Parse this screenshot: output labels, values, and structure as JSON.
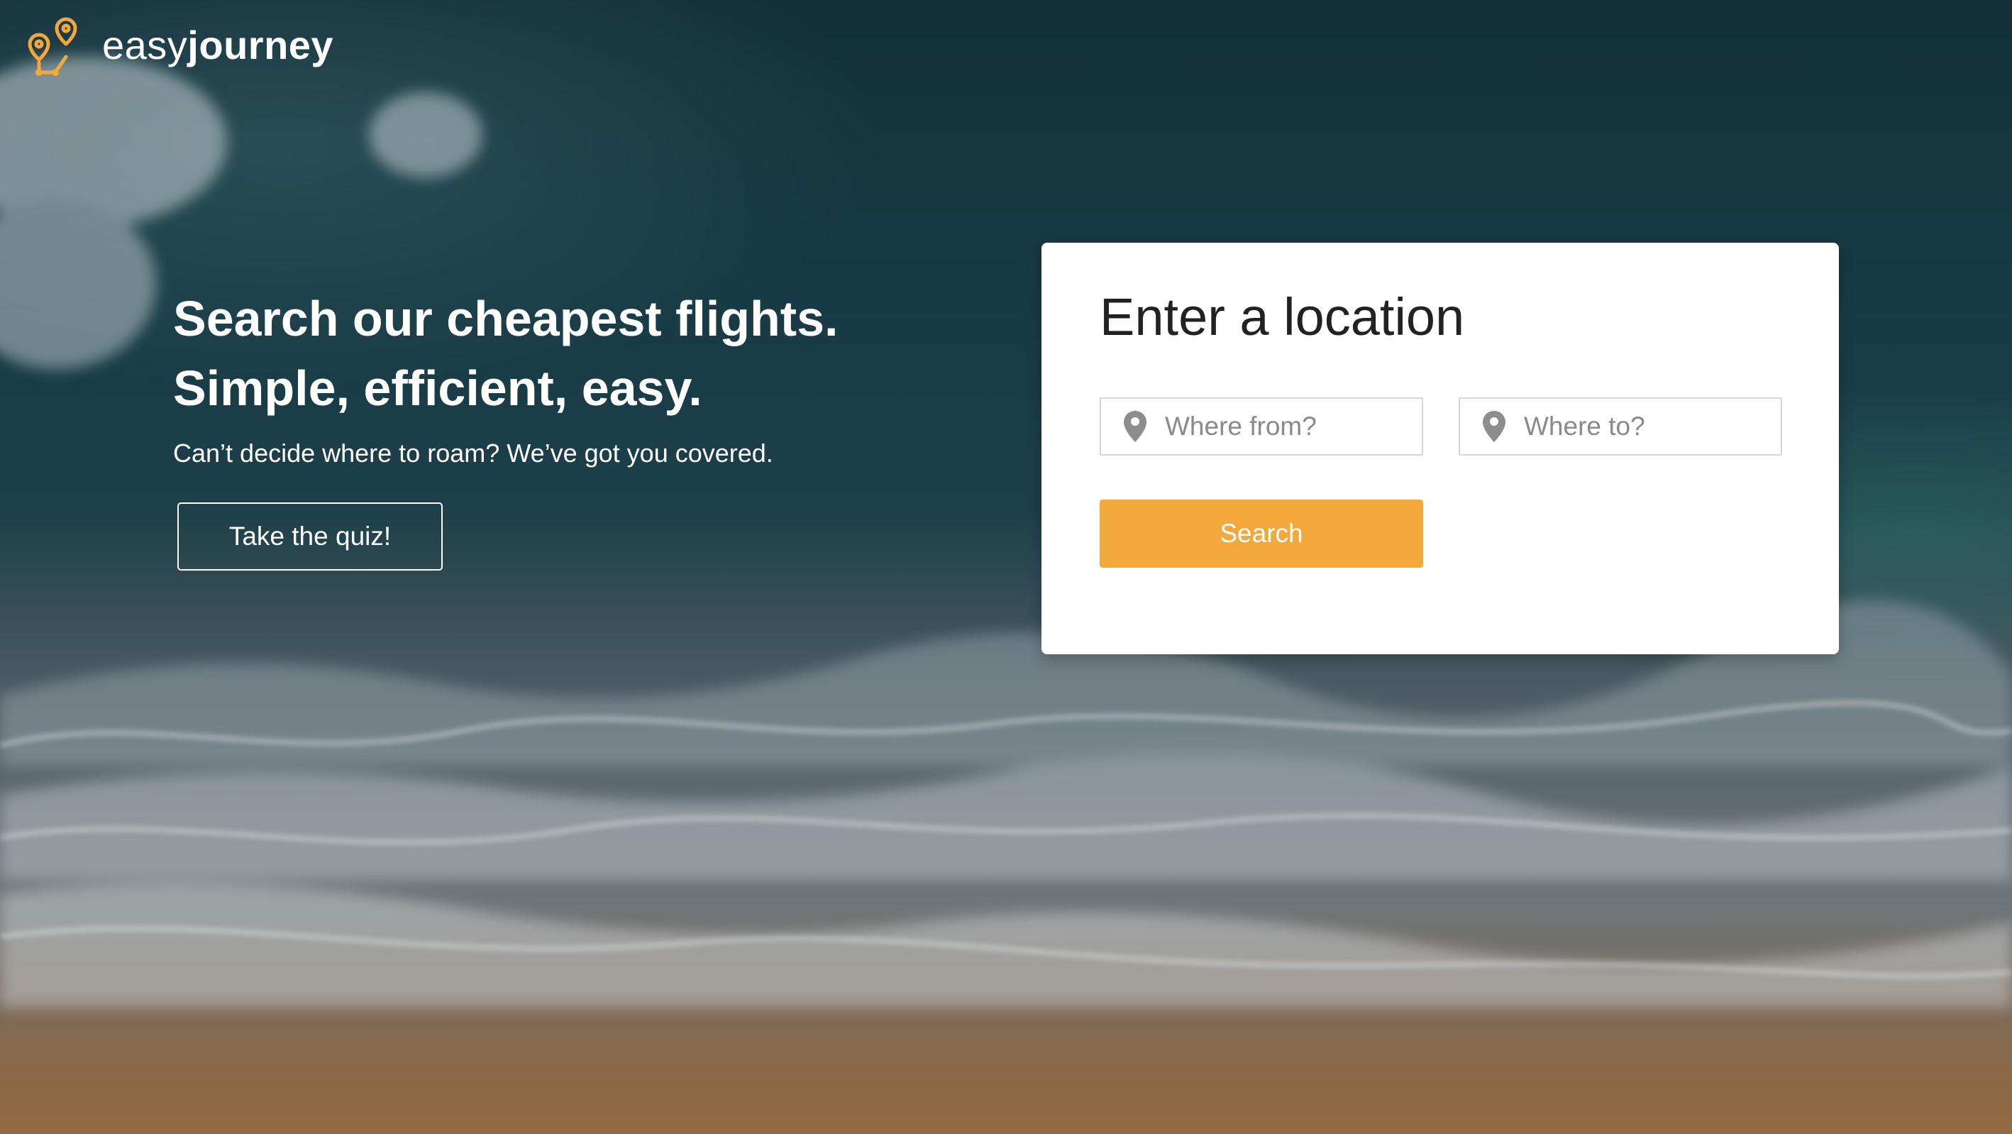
{
  "brand": {
    "name_light": "easy",
    "name_bold": "journey",
    "logo_icon": "map-pins-route-icon",
    "accent_color": "#f2a83b"
  },
  "hero": {
    "title_line1": "Search our cheapest flights.",
    "title_line2": "Simple, efficient, easy.",
    "subtitle": "Can’t decide where to roam? We’ve got you covered.",
    "quiz_button": "Take the quiz!"
  },
  "search_card": {
    "title": "Enter a location",
    "from_field": {
      "placeholder": "Where from?",
      "value": "",
      "icon": "location-pin-icon"
    },
    "to_field": {
      "placeholder": "Where to?",
      "value": "",
      "icon": "location-pin-icon"
    },
    "search_button": "Search"
  }
}
